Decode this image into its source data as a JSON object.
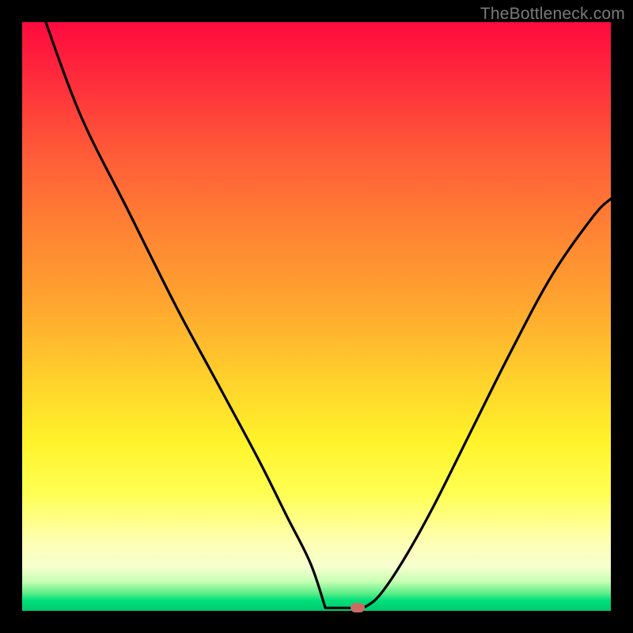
{
  "watermark": "TheBottleneck.com",
  "colors": {
    "frame": "#000000",
    "curve": "#000000",
    "marker": "#cc6a63",
    "gradient_stops": [
      "#ff0a3e",
      "#ff2d3c",
      "#ff5a38",
      "#ff8233",
      "#ffa62f",
      "#ffcf2c",
      "#fff22a",
      "#ffff52",
      "#ffffb0",
      "#f6ffcf",
      "#c8ffb4",
      "#5eed88",
      "#00e07a",
      "#00c96f"
    ]
  },
  "chart_data": {
    "type": "line",
    "title": "",
    "xlabel": "",
    "ylabel": "",
    "xlim": [
      0,
      100
    ],
    "ylim": [
      0,
      100
    ],
    "grid": false,
    "legend": false,
    "series": [
      {
        "name": "curve",
        "x": [
          4,
          10,
          18,
          26,
          33,
          40,
          45,
          49,
          51,
          53,
          55,
          57,
          58.5,
          61,
          65,
          70,
          76,
          83,
          90,
          97,
          100
        ],
        "y": [
          100,
          84,
          68,
          52,
          39,
          26,
          16,
          8,
          4,
          1.5,
          0.6,
          0.5,
          0.8,
          3,
          9,
          18,
          30,
          44,
          57,
          67,
          70
        ]
      }
    ],
    "marker": {
      "x": 57,
      "y": 0.5
    },
    "flat_segment": {
      "x_start": 51.5,
      "x_end": 57,
      "y": 0.5
    },
    "notes": "V-shaped bottleneck curve on rainbow heat gradient; minimum near x≈57 at bottom green band."
  }
}
